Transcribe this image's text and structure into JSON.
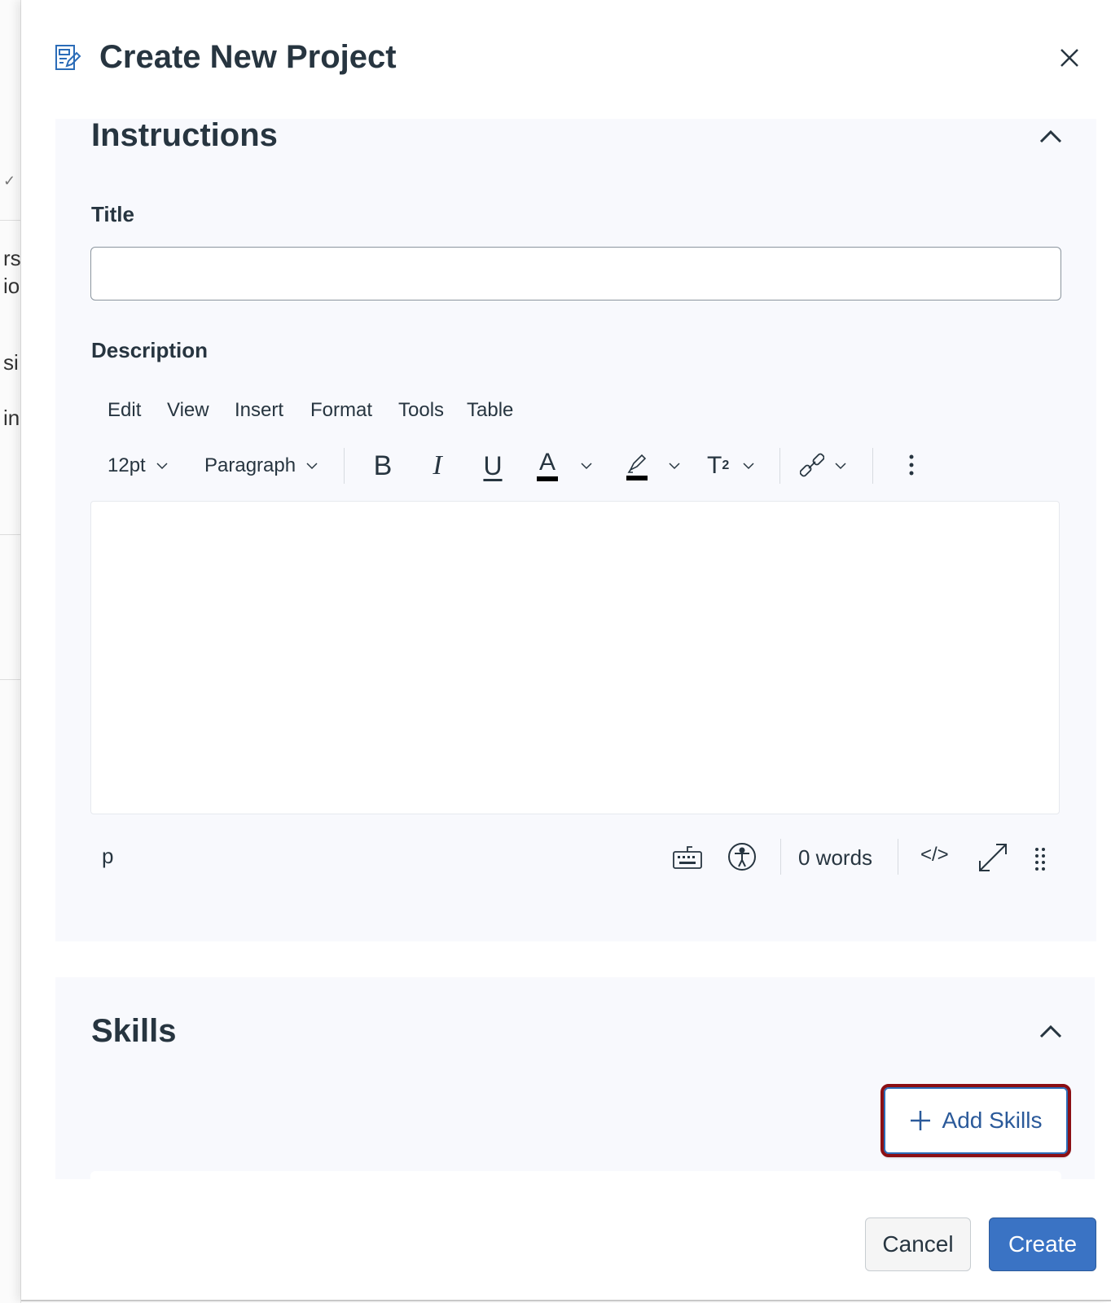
{
  "background_fragments": [
    "rs",
    "io",
    "si",
    "in"
  ],
  "dialog": {
    "title": "Create New Project",
    "close_label": "Close"
  },
  "instructions": {
    "heading": "Instructions",
    "title_label": "Title",
    "title_value": "",
    "title_placeholder": "",
    "description_label": "Description",
    "menu": [
      "Edit",
      "View",
      "Insert",
      "Format",
      "Tools",
      "Table"
    ],
    "toolbar": {
      "font_size": "12pt",
      "block_format": "Paragraph",
      "bold": "B",
      "italic": "I",
      "underline": "U",
      "text_color": "A",
      "superscript": "T",
      "superscript_mark": "2"
    },
    "status": {
      "path": "p",
      "word_count": "0 words",
      "html_toggle": "</>"
    }
  },
  "skills": {
    "heading": "Skills",
    "add_label": "Add Skills"
  },
  "footer": {
    "cancel": "Cancel",
    "create": "Create"
  },
  "colors": {
    "accent": "#2b6cb8",
    "create_bg": "#3a73c4",
    "focus_ring": "#8b0f14",
    "panel_bg": "#f8f9fd"
  }
}
